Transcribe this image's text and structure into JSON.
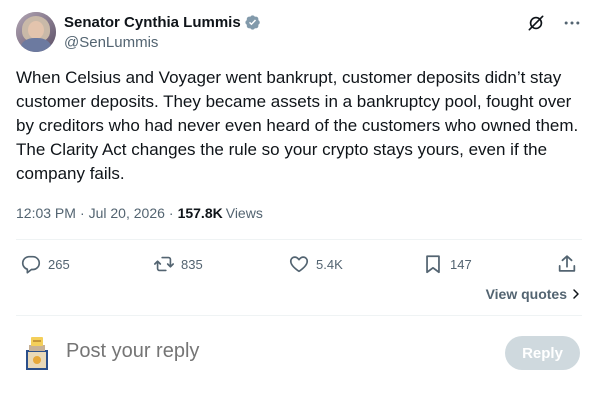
{
  "author": {
    "display_name": "Senator Cynthia Lummis",
    "handle": "@SenLummis",
    "verified_badge": "verified-badge-icon",
    "avatar": "avatar"
  },
  "header_icons": [
    "grok-icon",
    "more-options-icon"
  ],
  "tweet": {
    "text": "When Celsius and Voyager went bankrupt, customer deposits didn’t stay customer deposits. They became assets in a bankruptcy pool, fought over by creditors who had never even heard of the customers who owned them. The Clarity Act changes the rule so your crypto stays yours, even if the company fails."
  },
  "meta": {
    "time": "12:03 PM",
    "separator": "·",
    "date": "Jul 20, 2026",
    "views_count": "157.8K",
    "views_label": "Views"
  },
  "actions": {
    "replies": "265",
    "reposts": "835",
    "likes": "5.4K",
    "bookmarks": "147"
  },
  "view_quotes_label": "View quotes",
  "reply_composer": {
    "placeholder": "Post your reply",
    "button_label": "Reply"
  },
  "colors": {
    "text_primary": "#0f1419",
    "text_secondary": "#536471",
    "divider": "#eff3f4",
    "verified": "#829aab",
    "reply_button_disabled": "#cfd9de"
  }
}
